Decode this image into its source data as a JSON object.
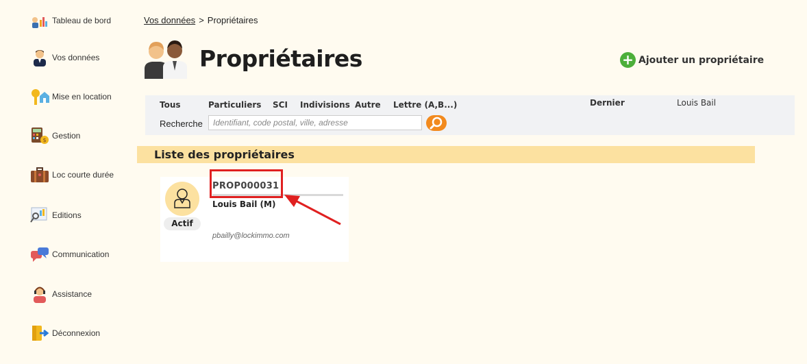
{
  "sidebar": {
    "items": [
      {
        "label": "Tableau de bord",
        "icon": "dashboard-icon"
      },
      {
        "label": "Vos données",
        "icon": "user-icon"
      },
      {
        "label": "Mise en location",
        "icon": "key-house-icon"
      },
      {
        "label": "Gestion",
        "icon": "calculator-icon"
      },
      {
        "label": "Loc courte durée",
        "icon": "suitcase-icon"
      },
      {
        "label": "Editions",
        "icon": "report-icon"
      },
      {
        "label": "Communication",
        "icon": "chat-icon"
      },
      {
        "label": "Assistance",
        "icon": "headset-icon"
      },
      {
        "label": "Déconnexion",
        "icon": "logout-icon"
      }
    ]
  },
  "breadcrumb": {
    "parent": "Vos données",
    "separator": ">",
    "current": "Propriétaires"
  },
  "page": {
    "title": "Propriétaires",
    "add_button": "Ajouter un propriétaire"
  },
  "filters": {
    "tabs": [
      "Tous",
      "Particuliers",
      "SCI",
      "Indivisions",
      "Autre",
      "Lettre (A,B...)"
    ],
    "search_label": "Recherche",
    "search_placeholder": "Identifiant, code postal, ville, adresse",
    "last_label": "Dernier",
    "last_value": "Louis Bail"
  },
  "list": {
    "header": "Liste des propriétaires",
    "owners": [
      {
        "id": "PROP000031",
        "name": "Louis Bail (M)",
        "email": "pbailly@lockimmo.com",
        "status": "Actif"
      }
    ]
  },
  "colors": {
    "background": "#fffbf0",
    "section_header": "#fce1a0",
    "add_button": "#4caf3a",
    "search_button": "#f28a1e",
    "highlight": "#e02020"
  }
}
